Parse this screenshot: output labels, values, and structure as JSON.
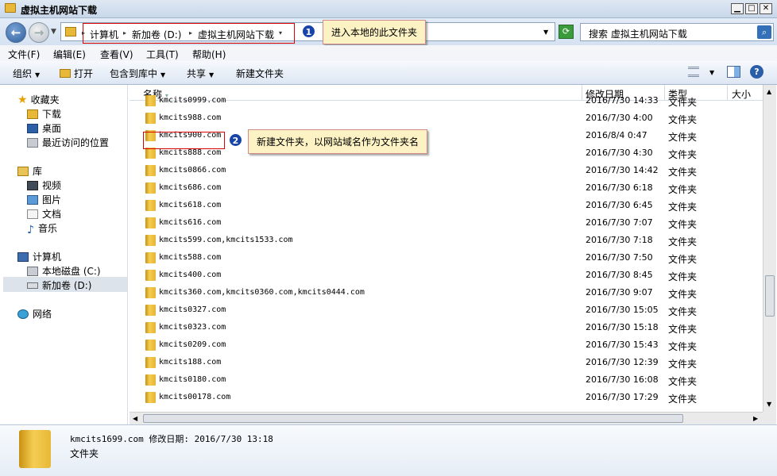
{
  "window": {
    "title": "虚拟主机网站下载"
  },
  "address": {
    "crumbs": [
      "计算机",
      "新加卷 (D:)",
      "虚拟主机网站下载"
    ],
    "search_placeholder": "搜索 虚拟主机网站下载"
  },
  "callouts": [
    {
      "num": "1",
      "text": "进入本地的此文件夹"
    },
    {
      "num": "2",
      "text": "新建文件夹，以网站域名作为文件夹名"
    }
  ],
  "menu": [
    "文件(F)",
    "编辑(E)",
    "查看(V)",
    "工具(T)",
    "帮助(H)"
  ],
  "toolbar": {
    "organize": "组织",
    "open": "打开",
    "include": "包含到库中",
    "share": "共享",
    "new_folder": "新建文件夹"
  },
  "nav": {
    "favorites": "收藏夹",
    "downloads": "下载",
    "desktop": "桌面",
    "recent": "最近访问的位置",
    "libraries": "库",
    "videos": "视频",
    "pictures": "图片",
    "documents": "文档",
    "music": "音乐",
    "computer": "计算机",
    "local_disk": "本地磁盘 (C:)",
    "new_volume": "新加卷 (D:)",
    "network": "网络"
  },
  "columns": {
    "name": "名称",
    "date": "修改日期",
    "type": "类型",
    "size": "大小"
  },
  "files": [
    {
      "name": "kmcits0999.com",
      "date": "2016/7/30 14:33",
      "type": "文件夹"
    },
    {
      "name": "kmcits988.com",
      "date": "2016/7/30 4:00",
      "type": "文件夹"
    },
    {
      "name": "kmcits900.com",
      "date": "2016/8/4 0:47",
      "type": "文件夹"
    },
    {
      "name": "kmcits888.com",
      "date": "2016/7/30 4:30",
      "type": "文件夹"
    },
    {
      "name": "kmcits0866.com",
      "date": "2016/7/30 14:42",
      "type": "文件夹"
    },
    {
      "name": "kmcits686.com",
      "date": "2016/7/30 6:18",
      "type": "文件夹"
    },
    {
      "name": "kmcits618.com",
      "date": "2016/7/30 6:45",
      "type": "文件夹"
    },
    {
      "name": "kmcits616.com",
      "date": "2016/7/30 7:07",
      "type": "文件夹"
    },
    {
      "name": "kmcits599.com,kmcits1533.com",
      "date": "2016/7/30 7:18",
      "type": "文件夹"
    },
    {
      "name": "kmcits588.com",
      "date": "2016/7/30 7:50",
      "type": "文件夹"
    },
    {
      "name": "kmcits400.com",
      "date": "2016/7/30 8:45",
      "type": "文件夹"
    },
    {
      "name": "kmcits360.com,kmcits0360.com,kmcits0444.com",
      "date": "2016/7/30 9:07",
      "type": "文件夹"
    },
    {
      "name": "kmcits0327.com",
      "date": "2016/7/30 15:05",
      "type": "文件夹"
    },
    {
      "name": "kmcits0323.com",
      "date": "2016/7/30 15:18",
      "type": "文件夹"
    },
    {
      "name": "kmcits0209.com",
      "date": "2016/7/30 15:43",
      "type": "文件夹"
    },
    {
      "name": "kmcits188.com",
      "date": "2016/7/30 12:39",
      "type": "文件夹"
    },
    {
      "name": "kmcits0180.com",
      "date": "2016/7/30 16:08",
      "type": "文件夹"
    },
    {
      "name": "kmcits00178.com",
      "date": "2016/7/30 17:29",
      "type": "文件夹"
    }
  ],
  "details": {
    "line1": "kmcits1699.com 修改日期: 2016/7/30 13:18",
    "line2": "文件夹"
  }
}
